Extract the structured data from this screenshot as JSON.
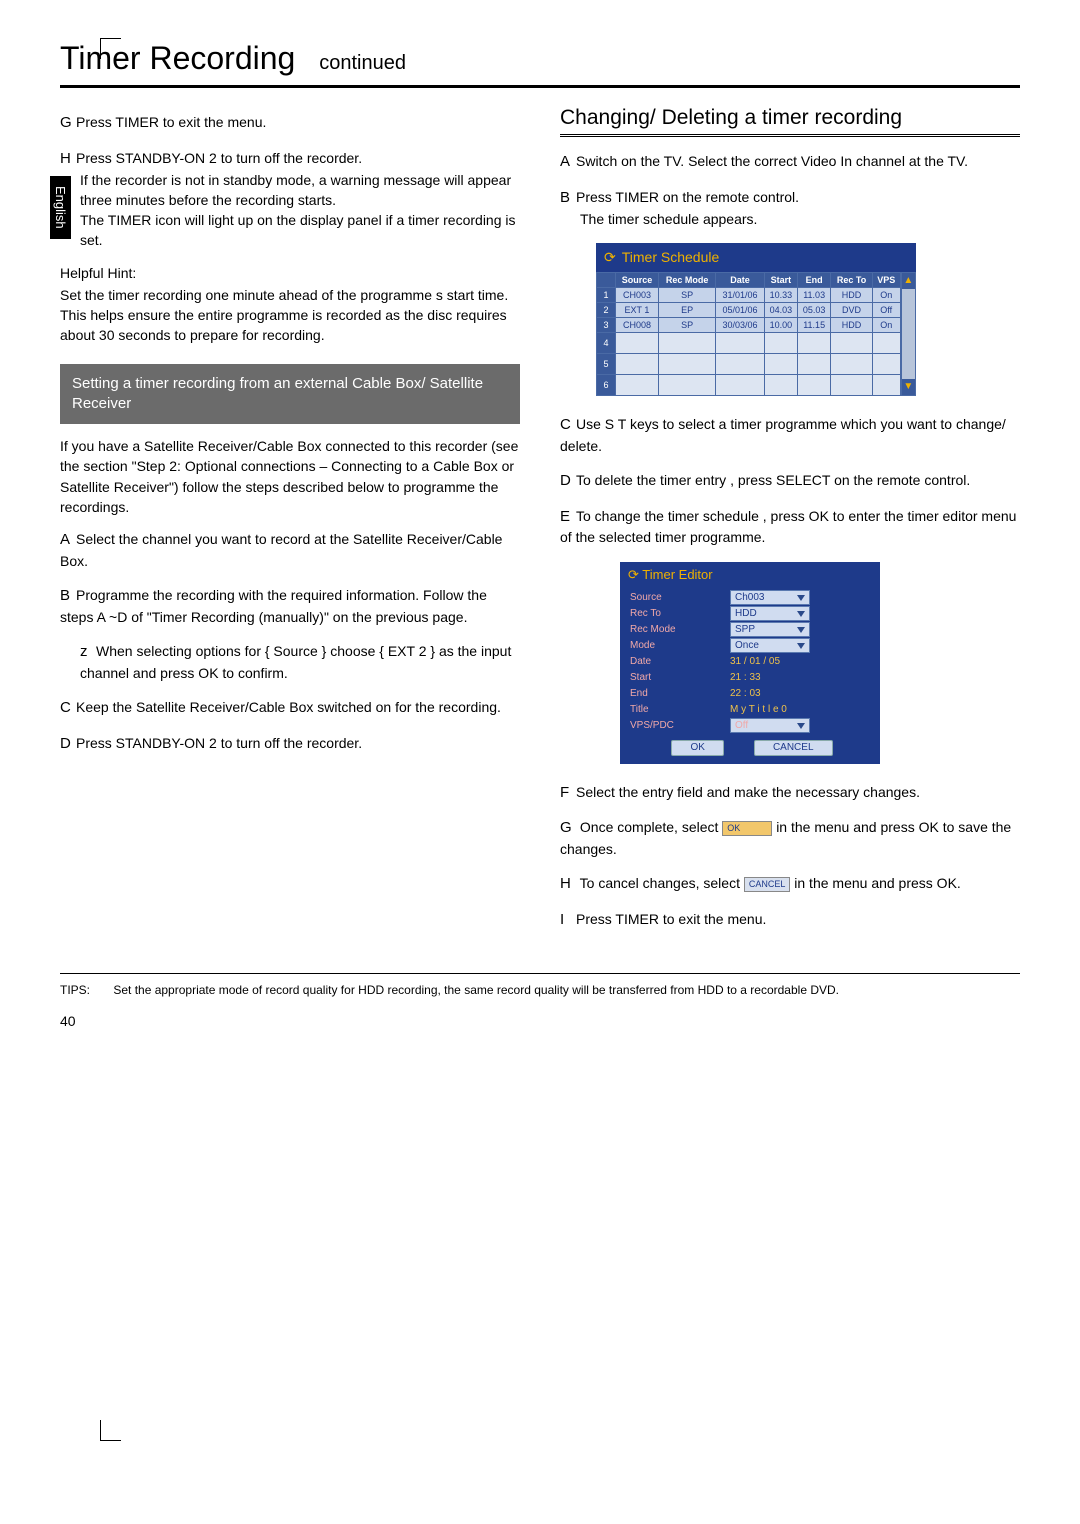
{
  "page": {
    "title": "Timer Recording",
    "subtitle": "continued",
    "lang": "English",
    "pagenum": "40"
  },
  "left": {
    "g": "Press TIMER to exit the menu.",
    "h": "Press STANDBY-ON 2 to turn off the recorder.",
    "h_sub1": "If the recorder is not in standby mode, a warning message will appear three minutes before the recording starts.",
    "h_sub2": "The TIMER icon will light up on the display panel if a timer recording is set.",
    "hint_head": "Helpful Hint:",
    "hint_body": "Set the timer recording one minute ahead of the programme s start time. This helps ensure the entire programme is recorded as the disc requires about 30 seconds to prepare for recording.",
    "section_box": "Setting a timer recording from an external Cable Box/ Satellite Receiver",
    "intro": "If you have a Satellite Receiver/Cable Box connected to this recorder (see the section \"Step 2: Optional connections – Connecting to a Cable Box or Satellite Receiver\") follow the steps described below to programme the recordings.",
    "a": "Select the channel you want to record at the Satellite Receiver/Cable Box.",
    "b": "Programme the recording with the required information. Follow the steps A ~D of \"Timer Recording (manually)\" on the previous page.",
    "z": "When selecting options for { Source } choose { EXT 2 } as the input channel and press OK to confirm.",
    "c": "Keep the Satellite Receiver/Cable Box switched on for the recording.",
    "d": "Press STANDBY-ON 2 to turn off the recorder."
  },
  "right": {
    "heading": "Changing/ Deleting a timer recording",
    "a": "Switch on the TV. Select the correct Video In channel at the TV.",
    "b": "Press TIMER on the remote control.",
    "b_sub": "The timer schedule appears.",
    "schedule_title": "Timer Schedule",
    "schedule_headers": [
      "Source",
      "Rec Mode",
      "Date",
      "Start",
      "End",
      "Rec To",
      "VPS"
    ],
    "schedule_rows": [
      {
        "n": "1",
        "cells": [
          "CH003",
          "SP",
          "31/01/06",
          "10.33",
          "11.03",
          "HDD",
          "On"
        ]
      },
      {
        "n": "2",
        "cells": [
          "EXT 1",
          "EP",
          "05/01/06",
          "04.03",
          "05.03",
          "DVD",
          "Off"
        ]
      },
      {
        "n": "3",
        "cells": [
          "CH008",
          "SP",
          "30/03/06",
          "10.00",
          "11.15",
          "HDD",
          "On"
        ]
      }
    ],
    "empty_nums": [
      "4",
      "5",
      "6"
    ],
    "c": "Use S T keys to select a timer programme which you want to change/ delete.",
    "d": "To delete the timer entry , press SELECT on the remote control.",
    "e": "To change the timer schedule , press OK to enter the timer editor menu of the selected timer programme.",
    "editor_title": "Timer Editor",
    "editor": {
      "Source": "Ch003",
      "RecTo": "HDD",
      "RecMode": "SPP",
      "Mode": "Once",
      "Date": "31 / 01 / 05",
      "Start": "21 : 33",
      "End": "22 : 03",
      "Title": "M y  T i t l e 0",
      "VPS": "Off",
      "ok": "OK",
      "cancel": "CANCEL"
    },
    "editor_labels": {
      "Source": "Source",
      "RecTo": "Rec To",
      "RecMode": "Rec Mode",
      "Mode": "Mode",
      "Date": "Date",
      "Start": "Start",
      "End": "End",
      "Title": "Title",
      "VPS": "VPS/PDC"
    },
    "f": "Select the entry field and make the necessary changes.",
    "g_pre": "Once complete, select",
    "g_post": "in the menu and press OK to save the changes.",
    "h_pre": "To cancel changes, select",
    "h_post": "in the menu and press OK.",
    "i": "Press TIMER to exit the menu.",
    "ok_btn": "OK",
    "cancel_btn": "CANCEL"
  },
  "tips": {
    "label": "TIPS:",
    "body": "Set the appropriate mode of record quality for HDD recording, the same record quality will be transferred from HDD to a recordable DVD."
  }
}
